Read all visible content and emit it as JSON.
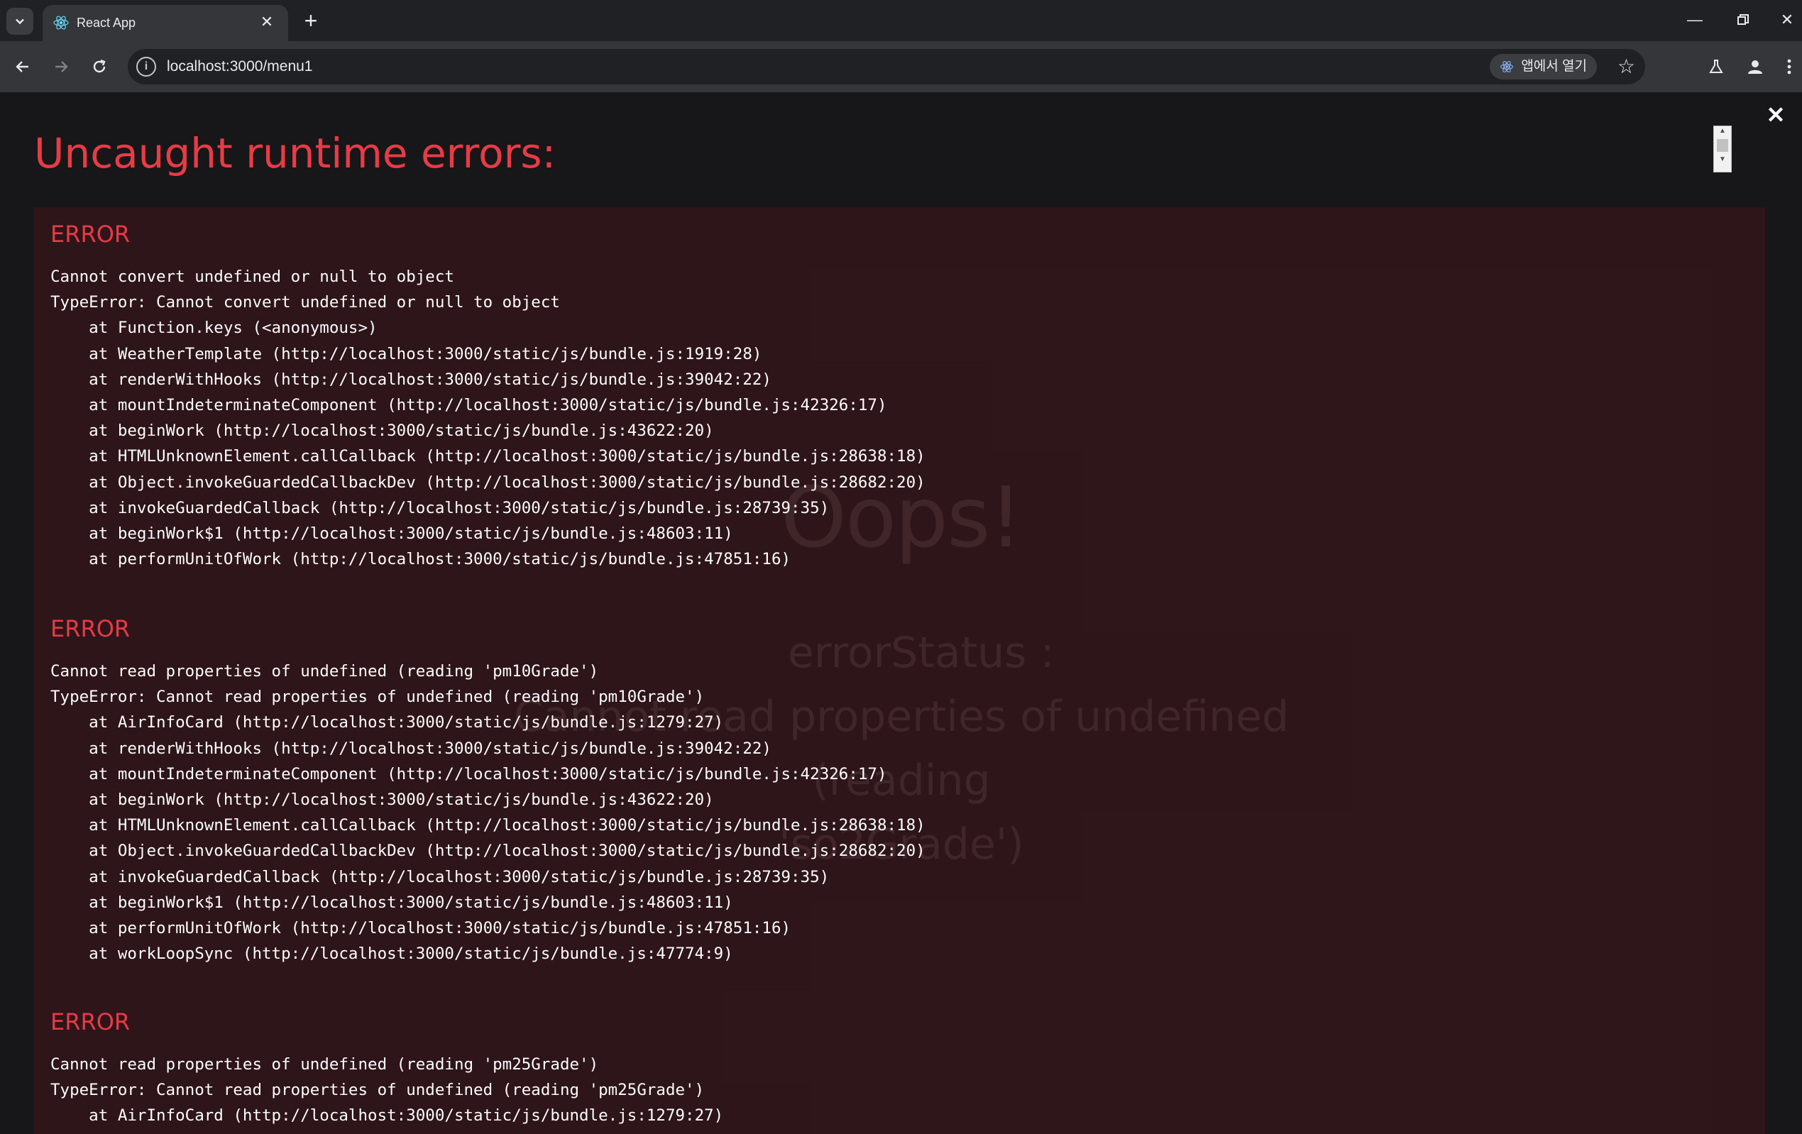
{
  "browser": {
    "tab_title": "React App",
    "url": "localhost:3000/menu1",
    "open_in_app_label": "앱에서 열기"
  },
  "background_app": {
    "heading": "Oops!",
    "status_label": "errorStatus :",
    "message_line1": "Cannot read properties of undefined (reading",
    "message_line2": "'so2Grade')"
  },
  "overlay": {
    "title": "Uncaught runtime errors:",
    "errors": [
      {
        "header": "ERROR",
        "lines": [
          "Cannot convert undefined or null to object",
          "TypeError: Cannot convert undefined or null to object",
          "    at Function.keys (<anonymous>)",
          "    at WeatherTemplate (http://localhost:3000/static/js/bundle.js:1919:28)",
          "    at renderWithHooks (http://localhost:3000/static/js/bundle.js:39042:22)",
          "    at mountIndeterminateComponent (http://localhost:3000/static/js/bundle.js:42326:17)",
          "    at beginWork (http://localhost:3000/static/js/bundle.js:43622:20)",
          "    at HTMLUnknownElement.callCallback (http://localhost:3000/static/js/bundle.js:28638:18)",
          "    at Object.invokeGuardedCallbackDev (http://localhost:3000/static/js/bundle.js:28682:20)",
          "    at invokeGuardedCallback (http://localhost:3000/static/js/bundle.js:28739:35)",
          "    at beginWork$1 (http://localhost:3000/static/js/bundle.js:48603:11)",
          "    at performUnitOfWork (http://localhost:3000/static/js/bundle.js:47851:16)"
        ]
      },
      {
        "header": "ERROR",
        "lines": [
          "Cannot read properties of undefined (reading 'pm10Grade')",
          "TypeError: Cannot read properties of undefined (reading 'pm10Grade')",
          "    at AirInfoCard (http://localhost:3000/static/js/bundle.js:1279:27)",
          "    at renderWithHooks (http://localhost:3000/static/js/bundle.js:39042:22)",
          "    at mountIndeterminateComponent (http://localhost:3000/static/js/bundle.js:42326:17)",
          "    at beginWork (http://localhost:3000/static/js/bundle.js:43622:20)",
          "    at HTMLUnknownElement.callCallback (http://localhost:3000/static/js/bundle.js:28638:18)",
          "    at Object.invokeGuardedCallbackDev (http://localhost:3000/static/js/bundle.js:28682:20)",
          "    at invokeGuardedCallback (http://localhost:3000/static/js/bundle.js:28739:35)",
          "    at beginWork$1 (http://localhost:3000/static/js/bundle.js:48603:11)",
          "    at performUnitOfWork (http://localhost:3000/static/js/bundle.js:47851:16)",
          "    at workLoopSync (http://localhost:3000/static/js/bundle.js:47774:9)"
        ]
      },
      {
        "header": "ERROR",
        "lines": [
          "Cannot read properties of undefined (reading 'pm25Grade')",
          "TypeError: Cannot read properties of undefined (reading 'pm25Grade')",
          "    at AirInfoCard (http://localhost:3000/static/js/bundle.js:1279:27)"
        ]
      }
    ]
  },
  "colors": {
    "error_red": "#e83b46",
    "panel_bg": "#2c181c",
    "page_bg": "#1d1c1e"
  }
}
